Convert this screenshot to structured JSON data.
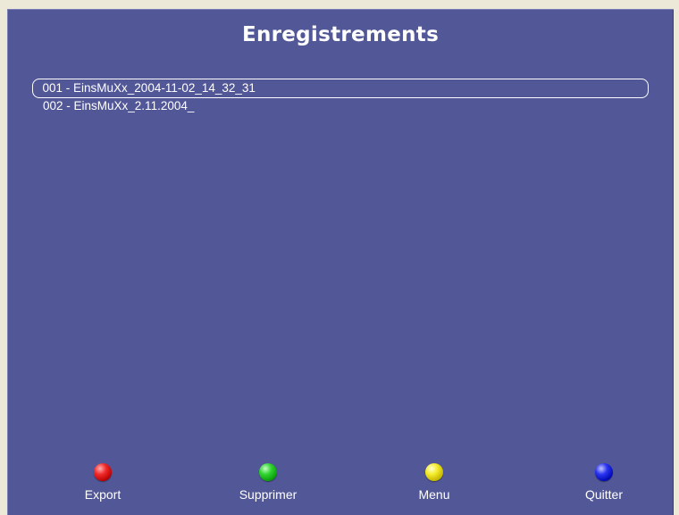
{
  "screen": {
    "title": "Enregistrements",
    "background_color": "#525797"
  },
  "recordings": [
    {
      "label": "001 - EinsMuXx_2004-11-02_14_32_31",
      "selected": true
    },
    {
      "label": "002 - EinsMuXx_2.11.2004_",
      "selected": false
    }
  ],
  "buttons": {
    "export": {
      "label": "Export",
      "color": "#e01c1c",
      "icon": "red-ball-icon"
    },
    "supprimer": {
      "label": "Supprimer",
      "color": "#1fbf1f",
      "icon": "green-ball-icon"
    },
    "menu": {
      "label": "Menu",
      "color": "#e8e01a",
      "icon": "yellow-ball-icon"
    },
    "quitter": {
      "label": "Quitter",
      "color": "#1a22d6",
      "icon": "blue-ball-icon"
    }
  }
}
